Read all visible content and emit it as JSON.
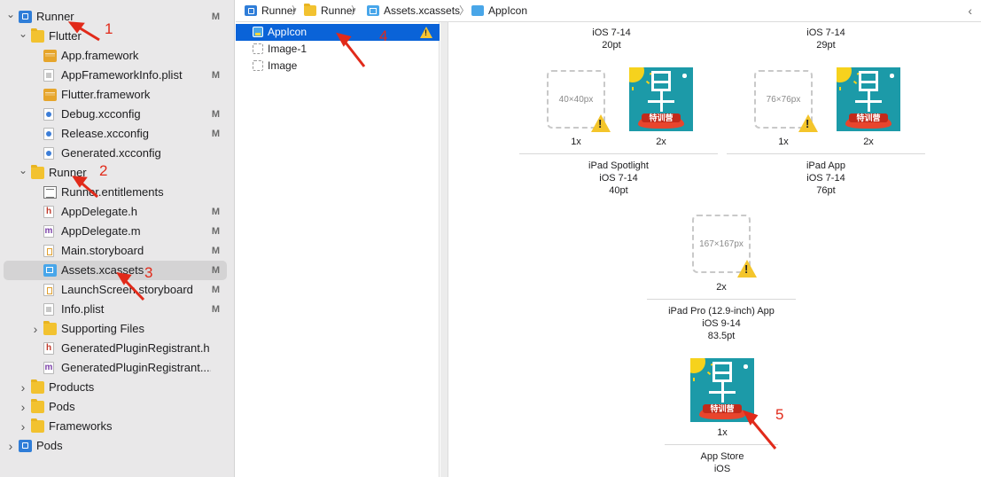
{
  "navigator": {
    "items": [
      {
        "label": "Runner",
        "badge": "M",
        "icon": "project-icon",
        "chevron": "down"
      },
      {
        "label": "Flutter",
        "badge": "",
        "icon": "folder-icon",
        "chevron": "down"
      },
      {
        "label": "App.framework",
        "badge": "",
        "icon": "framework-icon",
        "chevron": ""
      },
      {
        "label": "AppFrameworkInfo.plist",
        "badge": "M",
        "icon": "plist-icon",
        "chevron": ""
      },
      {
        "label": "Flutter.framework",
        "badge": "",
        "icon": "framework-icon",
        "chevron": ""
      },
      {
        "label": "Debug.xcconfig",
        "badge": "M",
        "icon": "xcconfig-icon",
        "chevron": ""
      },
      {
        "label": "Release.xcconfig",
        "badge": "M",
        "icon": "xcconfig-icon",
        "chevron": ""
      },
      {
        "label": "Generated.xcconfig",
        "badge": "",
        "icon": "xcconfig-icon",
        "chevron": ""
      },
      {
        "label": "Runner",
        "badge": "",
        "icon": "folder-icon",
        "chevron": "down"
      },
      {
        "label": "Runner.entitlements",
        "badge": "",
        "icon": "entitlements-icon",
        "chevron": ""
      },
      {
        "label": "AppDelegate.h",
        "badge": "M",
        "icon": "header-file-icon",
        "chevron": ""
      },
      {
        "label": "AppDelegate.m",
        "badge": "M",
        "icon": "objc-file-icon",
        "chevron": ""
      },
      {
        "label": "Main.storyboard",
        "badge": "M",
        "icon": "storyboard-icon",
        "chevron": ""
      },
      {
        "label": "Assets.xcassets",
        "badge": "M",
        "icon": "asset-catalog-icon",
        "chevron": "",
        "selected": true
      },
      {
        "label": "LaunchScreen.storyboard",
        "badge": "M",
        "icon": "storyboard-icon",
        "chevron": ""
      },
      {
        "label": "Info.plist",
        "badge": "M",
        "icon": "plist-icon",
        "chevron": ""
      },
      {
        "label": "Supporting Files",
        "badge": "",
        "icon": "folder-icon",
        "chevron": "right"
      },
      {
        "label": "GeneratedPluginRegistrant.h",
        "badge": "",
        "icon": "header-file-icon",
        "chevron": ""
      },
      {
        "label": "GeneratedPluginRegistrant....",
        "badge": "",
        "icon": "objc-file-icon",
        "chevron": ""
      },
      {
        "label": "Products",
        "badge": "",
        "icon": "folder-icon",
        "chevron": "right"
      },
      {
        "label": "Pods",
        "badge": "",
        "icon": "folder-icon",
        "chevron": "right"
      },
      {
        "label": "Frameworks",
        "badge": "",
        "icon": "folder-icon",
        "chevron": "right"
      },
      {
        "label": "Pods",
        "badge": "",
        "icon": "project-icon",
        "chevron": "right"
      }
    ]
  },
  "jumpbar": {
    "crumbs": [
      "Runner",
      "Runner",
      "Assets.xcassets",
      "AppIcon"
    ],
    "back_glyph": "‹"
  },
  "asset_list": {
    "items": [
      {
        "label": "AppIcon",
        "selected": true,
        "warning": true
      },
      {
        "label": "Image-1",
        "selected": false,
        "warning": false
      },
      {
        "label": "Image",
        "selected": false,
        "warning": false
      }
    ]
  },
  "canvas": {
    "top_left": {
      "line1": "iOS 7-14",
      "line2": "20pt"
    },
    "top_right": {
      "line1": "iOS 7-14",
      "line2": "29pt"
    },
    "spotlight": {
      "slot_1x": "40×40px",
      "scale_1x": "1x",
      "scale_2x": "2x",
      "title": "iPad Spotlight",
      "os": "iOS 7-14",
      "size": "40pt"
    },
    "ipad_app": {
      "slot_1x": "76×76px",
      "scale_1x": "1x",
      "scale_2x": "2x",
      "title": "iPad App",
      "os": "iOS 7-14",
      "size": "76pt"
    },
    "ipad_pro": {
      "slot_2x": "167×167px",
      "scale_2x": "2x",
      "title": "iPad Pro (12.9-inch) App",
      "os": "iOS 9-14",
      "size": "83.5pt"
    },
    "app_store": {
      "scale_1x": "1x",
      "title": "App Store",
      "os": "iOS"
    },
    "icon_banner_text": "特训营",
    "warning_glyph": "!"
  },
  "annotations": {
    "numbers": [
      "1",
      "2",
      "3",
      "4",
      "5"
    ],
    "color": "#e12a1a"
  },
  "colors": {
    "selection_blue": "#0a63d8",
    "warning_yellow": "#f4c52b",
    "icon_teal": "#1c9aa8"
  }
}
